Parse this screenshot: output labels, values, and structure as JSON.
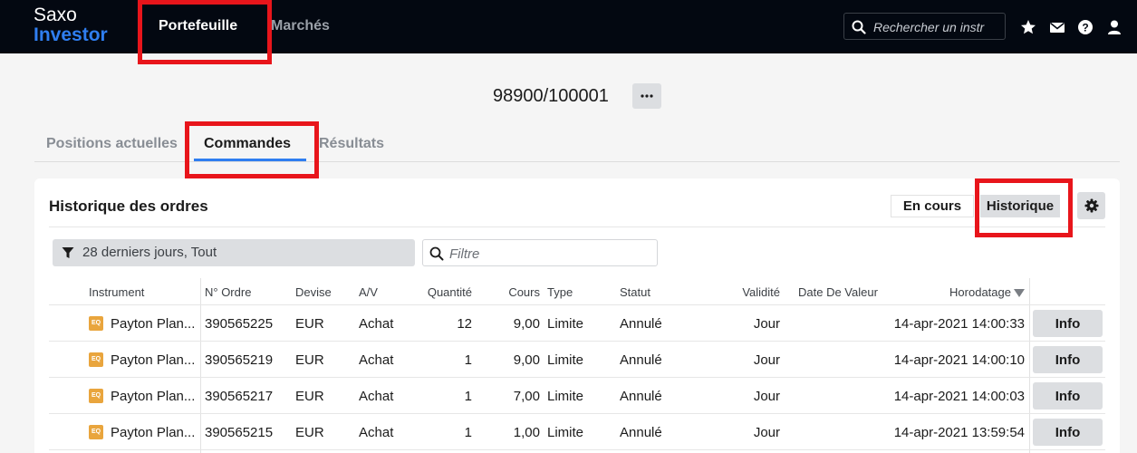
{
  "topbar": {
    "logo_line1": "Saxo",
    "logo_line2": "Investor",
    "nav": [
      "Portefeuille",
      "Marchés"
    ],
    "search_placeholder": "Rechercher un instr",
    "icons": [
      "search-icon",
      "star-icon",
      "mail-icon",
      "help-icon",
      "user-icon"
    ]
  },
  "account": {
    "id": "98900/100001"
  },
  "tabs": [
    "Positions actuelles",
    "Commandes",
    "Résultats"
  ],
  "active_tab": "Commandes",
  "card": {
    "title": "Historique des ordres",
    "segments": [
      "En cours",
      "Historique"
    ],
    "active_segment": "Historique",
    "filter_label": "28 derniers jours, Tout",
    "filter_placeholder": "Filtre"
  },
  "table": {
    "headers": {
      "instrument": "Instrument",
      "order_no": "N° Ordre",
      "currency": "Devise",
      "side": "A/V",
      "quantity": "Quantité",
      "price": "Cours",
      "type": "Type",
      "status": "Statut",
      "validity": "Validité",
      "value_date": "Date De Valeur",
      "timestamp": "Horodatage"
    },
    "badge": "EQ",
    "info_label": "Info",
    "rows": [
      {
        "instrument": "Payton Plan...",
        "order_no": "390565225",
        "currency": "EUR",
        "side": "Achat",
        "quantity": "12",
        "price": "9,00",
        "type": "Limite",
        "status": "Annulé",
        "validity": "Jour",
        "timestamp": "14-apr-2021 14:00:33"
      },
      {
        "instrument": "Payton Plan...",
        "order_no": "390565219",
        "currency": "EUR",
        "side": "Achat",
        "quantity": "1",
        "price": "9,00",
        "type": "Limite",
        "status": "Annulé",
        "validity": "Jour",
        "timestamp": "14-apr-2021 14:00:10"
      },
      {
        "instrument": "Payton Plan...",
        "order_no": "390565217",
        "currency": "EUR",
        "side": "Achat",
        "quantity": "1",
        "price": "7,00",
        "type": "Limite",
        "status": "Annulé",
        "validity": "Jour",
        "timestamp": "14-apr-2021 14:00:03"
      },
      {
        "instrument": "Payton Plan...",
        "order_no": "390565215",
        "currency": "EUR",
        "side": "Achat",
        "quantity": "1",
        "price": "1,00",
        "type": "Limite",
        "status": "Annulé",
        "validity": "Jour",
        "timestamp": "14-apr-2021 13:59:54"
      }
    ]
  },
  "colors": {
    "topbar_bg": "#030811",
    "accent_blue": "#2f7ef0",
    "highlight_red": "#e8151b",
    "eq_badge": "#e9a53d"
  }
}
